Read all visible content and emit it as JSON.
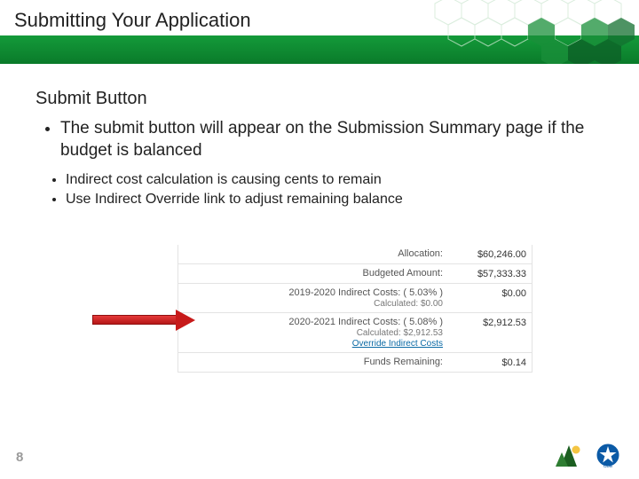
{
  "header": {
    "title": "Submitting Your Application"
  },
  "subhead": "Submit Button",
  "bullets": {
    "b1": "The submit button will appear on the Submission Summary page if the budget is balanced",
    "b2a": "Indirect cost calculation is causing cents to remain",
    "b2b": "Use Indirect Override link to adjust remaining balance"
  },
  "budget": {
    "rows": [
      {
        "label": "Allocation:",
        "sub": "",
        "link": "",
        "value": "$60,246.00"
      },
      {
        "label": "Budgeted Amount:",
        "sub": "",
        "link": "",
        "value": "$57,333.33"
      },
      {
        "label": "2019-2020 Indirect Costs: ( 5.03% )",
        "sub": "Calculated: $0.00",
        "link": "",
        "value": "$0.00"
      },
      {
        "label": "2020-2021 Indirect Costs: ( 5.08% )",
        "sub": "Calculated: $2,912.53",
        "link": "Override Indirect Costs",
        "value": "$2,912.53"
      },
      {
        "label": "Funds Remaining:",
        "sub": "",
        "link": "",
        "value": "$0.14"
      }
    ]
  },
  "page_number": "8",
  "logos": {
    "cde_label": "CDE"
  },
  "colors": {
    "header_green": "#0a7a2a",
    "arrow_red": "#c71a1a",
    "link_blue": "#0b6aa5"
  }
}
